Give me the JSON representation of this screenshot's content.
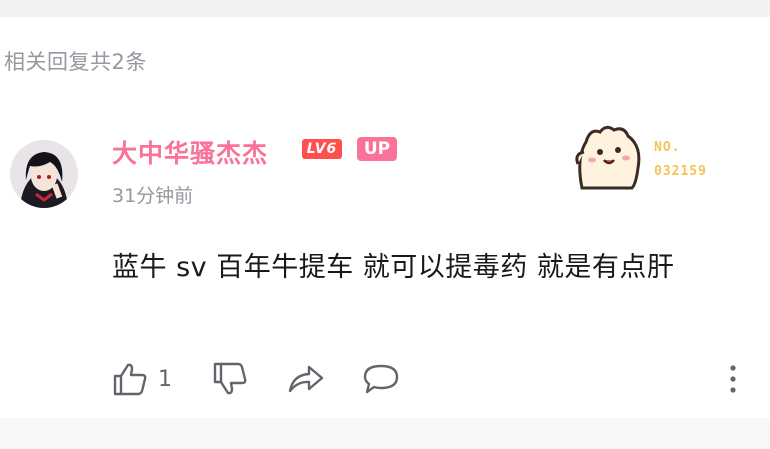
{
  "header": {
    "replies_label": "相关回复共2条"
  },
  "comment": {
    "username": "大中华骚杰杰",
    "level_badge": "LV6",
    "up_badge": "UP",
    "time": "31分钟前",
    "text": "蓝牛 sv 百年牛提车 就可以提毒药 就是有点肝",
    "likes": "1"
  },
  "fan_badge": {
    "no_label": "NO.",
    "number": "032159"
  },
  "colors": {
    "username": "#fb7299",
    "level_badge": "#ff4f4f",
    "up_badge": "#fb7299",
    "fan_badge": "#f4c454",
    "secondary_text": "#9499a0"
  },
  "icons": [
    "thumbs-up-icon",
    "thumbs-down-icon",
    "share-icon",
    "comment-icon",
    "more-vertical-icon"
  ]
}
